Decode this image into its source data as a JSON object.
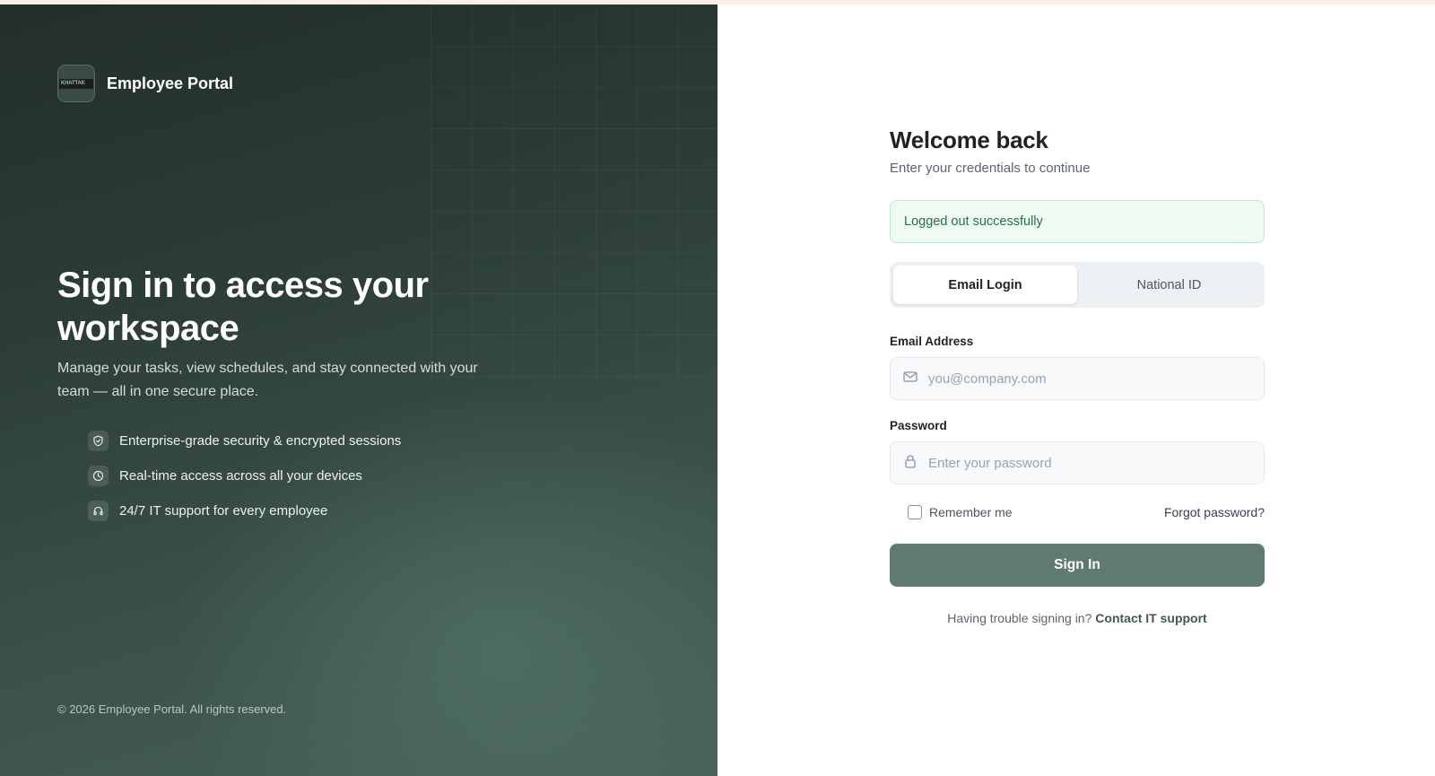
{
  "brand": {
    "name": "Employee Portal",
    "logo_text": "KHATTAK"
  },
  "hero": {
    "title": "Sign in to access your workspace",
    "subtitle": "Manage your tasks, view schedules, and stay connected with your team — all in one secure place.",
    "features": [
      {
        "icon": "shield-icon",
        "text": "Enterprise-grade security & encrypted sessions"
      },
      {
        "icon": "clock-icon",
        "text": "Real-time access across all your devices"
      },
      {
        "icon": "headset-icon",
        "text": "24/7 IT support for every employee"
      }
    ]
  },
  "footer": {
    "copyright": "© 2026 Employee Portal. All rights reserved."
  },
  "login": {
    "title": "Welcome back",
    "subtitle": "Enter your credentials to continue",
    "alert": "Logged out successfully",
    "tabs": [
      {
        "label": "Email Login",
        "active": true
      },
      {
        "label": "National ID",
        "active": false
      }
    ],
    "email": {
      "label": "Email Address",
      "placeholder": "you@company.com",
      "value": ""
    },
    "password": {
      "label": "Password",
      "placeholder": "Enter your password",
      "value": ""
    },
    "remember_label": "Remember me",
    "forgot_label": "Forgot password?",
    "submit_label": "Sign In",
    "help_text": "Having trouble signing in?",
    "help_link": "Contact IT support"
  },
  "colors": {
    "panel_dark": "#2c3d37",
    "accent_button": "#5f7a70",
    "alert_bg": "#eefbf3",
    "alert_text": "#2f6b45"
  }
}
